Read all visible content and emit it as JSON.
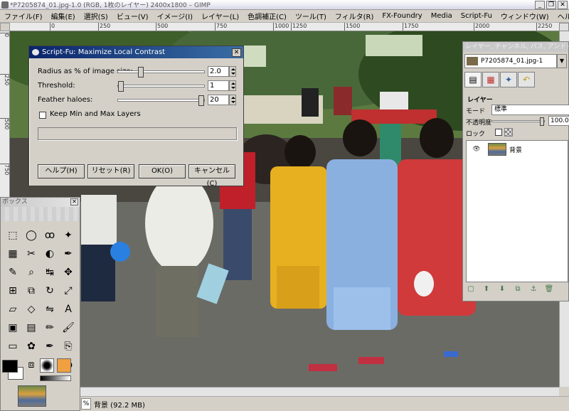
{
  "window": {
    "title": "*P7205874_01.jpg-1.0 (RGB, 1枚のレイヤー) 2400x1800 – GIMP",
    "buttons": [
      "_",
      "❐",
      "✕"
    ]
  },
  "menu": [
    "ファイル(F)",
    "編集(E)",
    "選択(S)",
    "ビュー(V)",
    "イメージ(I)",
    "レイヤー(L)",
    "色調補正(C)",
    "ツール(T)",
    "フィルタ(R)",
    "FX-Foundry",
    "Media",
    "Script-Fu",
    "ウィンドウ(W)",
    "ヘルプ(H)"
  ],
  "rulers": {
    "top": [
      "0",
      "250",
      "500",
      "750",
      "1000",
      "1250",
      "1500",
      "1750",
      "2000",
      "2250"
    ],
    "left": [
      "0",
      "250",
      "500",
      "750",
      "1000",
      "1250",
      "1500",
      "1750"
    ]
  },
  "status": {
    "unit": "%",
    "text": "背景 (92.2 MB)"
  },
  "dialog": {
    "title": "Script-Fu: Maximize Local Contrast",
    "radius_label": "Radius as % of image size:",
    "radius_value": "2.0",
    "radius_level": 0.25,
    "threshold_label": "Threshold:",
    "threshold_value": "1",
    "threshold_level": 0.0,
    "feather_label": "Feather haloes:",
    "feather_value": "20",
    "feather_level": 1.0,
    "keep_label": "Keep Min and Max Layers",
    "keep_checked": false,
    "buttons": {
      "help": "ヘルプ(H)",
      "reset": "リセット(R)",
      "ok": "OK(O)",
      "cancel": "キャンセル(C)"
    }
  },
  "toolbox": {
    "title": "ボックス",
    "tools": [
      "rect-select-icon",
      "ellipse-select-icon",
      "lasso-icon",
      "fuzzy-select-icon",
      "color-select-icon",
      "scissors-icon",
      "foreground-select-icon",
      "paths-icon",
      "color-picker-icon",
      "zoom-icon",
      "measure-icon",
      "move-icon",
      "align-icon",
      "crop-icon",
      "rotate-icon",
      "scale-icon",
      "shear-icon",
      "perspective-icon",
      "flip-icon",
      "text-icon",
      "bucket-fill-icon",
      "blend-icon",
      "pencil-icon",
      "paintbrush-icon",
      "eraser-icon",
      "airbrush-icon",
      "ink-icon",
      "clone-icon",
      "heal-icon",
      "perspective-clone-icon",
      "smudge-icon",
      "dodge-burn-icon"
    ],
    "glyphs": [
      "⬚",
      "◯",
      "ꝏ",
      "✦",
      "▦",
      "✂",
      "◐",
      "✒",
      "✎",
      "⌕",
      "↹",
      "✥",
      "⊞",
      "⧉",
      "↻",
      "⤢",
      "▱",
      "◇",
      "⇋",
      "A",
      "▣",
      "▤",
      "✏",
      "🖌",
      "▭",
      "✿",
      "✒",
      "⎘",
      "✚",
      "⧈",
      "∿",
      "◑"
    ]
  },
  "layers": {
    "title": "レイヤー, チャンネル, パス, アンドゥ",
    "image_name": "P7205874_01.jpg-1",
    "auto": "自動",
    "section": "レイヤー",
    "mode_label": "モード",
    "mode_value": "標準",
    "opacity_label": "不透明度",
    "opacity_value": "100.0",
    "opacity_level": 1.0,
    "lock_label": "ロック",
    "layer_name": "背景",
    "tabs": [
      "layers-tab-icon",
      "channels-tab-icon",
      "paths-tab-icon",
      "undo-tab-icon"
    ],
    "bottom_icons": [
      "new-layer-icon",
      "raise-layer-icon",
      "lower-layer-icon",
      "duplicate-layer-icon",
      "anchor-layer-icon",
      "delete-layer-icon"
    ]
  }
}
